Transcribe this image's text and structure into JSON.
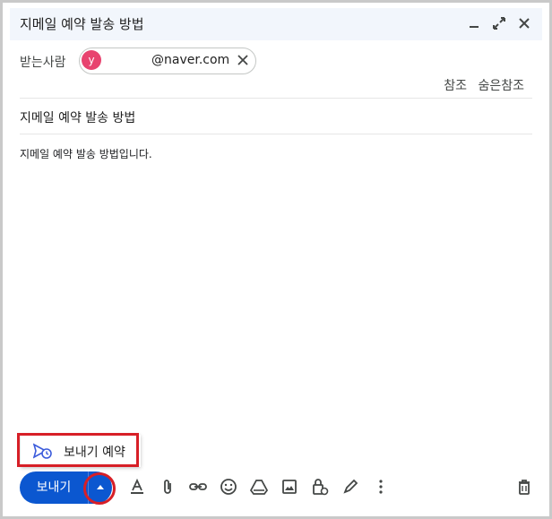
{
  "window": {
    "title": "지메일 예약 발송 방법"
  },
  "recipients": {
    "label": "받는사람",
    "chip": {
      "avatar_letter": "y",
      "address": "@naver.com"
    },
    "cc_label": "참조",
    "bcc_label": "숨은참조"
  },
  "subject": "지메일 예약 발송 방법",
  "body": "지메일 예약 발송 방법입니다.",
  "schedule_menu": {
    "label": "보내기 예약"
  },
  "send": {
    "label": "보내기"
  },
  "colors": {
    "accent": "#0b57d0",
    "highlight": "#d71f27",
    "avatar": "#e8436f"
  }
}
